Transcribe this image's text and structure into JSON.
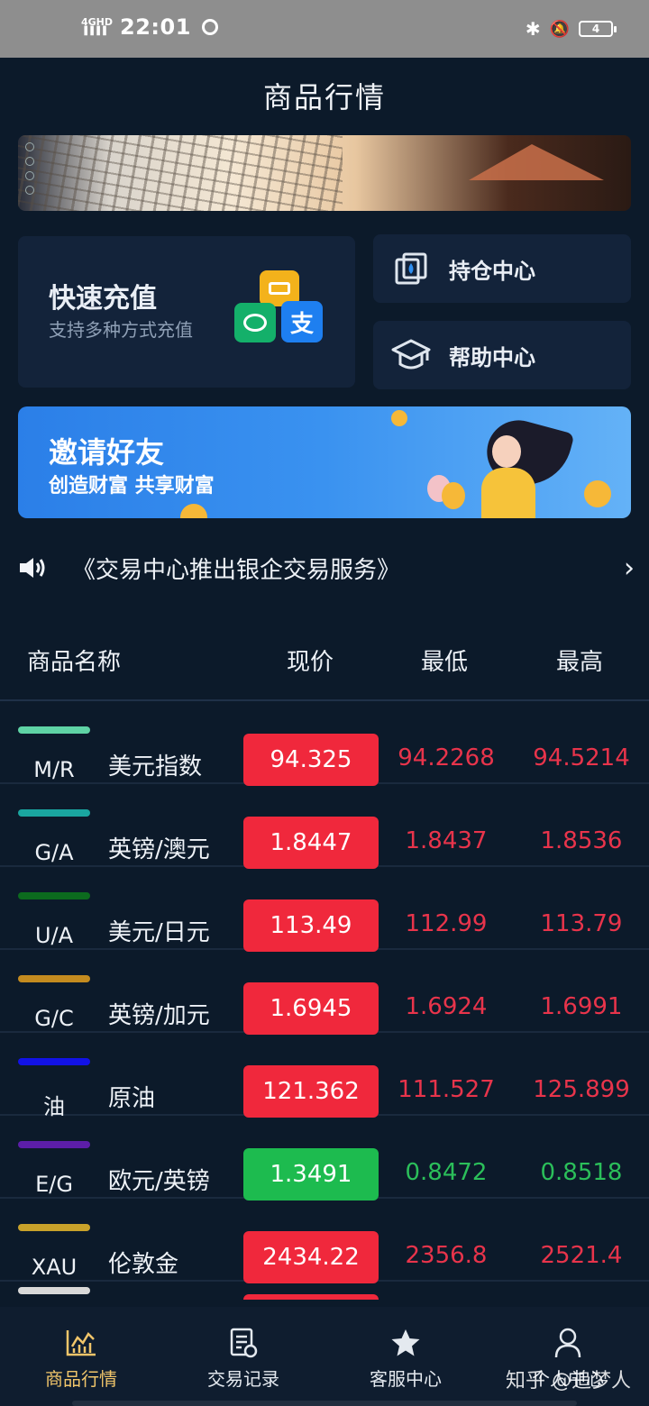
{
  "status_bar": {
    "network": "4GHD",
    "signal": "▐▐▐▐",
    "time": "22:01",
    "battery": "4"
  },
  "header": {
    "title": "商品行情"
  },
  "recharge": {
    "title": "快速充值",
    "subtitle": "支持多种方式充值",
    "alipay_char": "支"
  },
  "menu": {
    "hold": "持仓中心",
    "help": "帮助中心"
  },
  "invite": {
    "title": "邀请好友",
    "subtitle": "创造财富 共享财富"
  },
  "notice": {
    "text": "《交易中心推出银企交易服务》"
  },
  "table": {
    "headers": {
      "name": "商品名称",
      "price": "现价",
      "low": "最低",
      "high": "最高"
    },
    "rows": [
      {
        "code": "M/R",
        "name": "美元指数",
        "price": "94.325",
        "low": "94.2268",
        "high": "94.5214",
        "trend": "up",
        "tag_color": "#5fd3a5"
      },
      {
        "code": "G/A",
        "name": "英镑/澳元",
        "price": "1.8447",
        "low": "1.8437",
        "high": "1.8536",
        "trend": "up",
        "tag_color": "#1aa6a0"
      },
      {
        "code": "U/A",
        "name": "美元/日元",
        "price": "113.49",
        "low": "112.99",
        "high": "113.79",
        "trend": "up",
        "tag_color": "#0c6b1e"
      },
      {
        "code": "G/C",
        "name": "英镑/加元",
        "price": "1.6945",
        "low": "1.6924",
        "high": "1.6991",
        "trend": "up",
        "tag_color": "#c48b1f"
      },
      {
        "code": "油",
        "name": "原油",
        "price": "121.362",
        "low": "111.527",
        "high": "125.899",
        "trend": "up",
        "tag_color": "#1212e6"
      },
      {
        "code": "E/G",
        "name": "欧元/英镑",
        "price": "1.3491",
        "low": "0.8472",
        "high": "0.8518",
        "trend": "down",
        "tag_color": "#5c1ea8"
      },
      {
        "code": "XAU",
        "name": "伦敦金",
        "price": "2434.22",
        "low": "2356.8",
        "high": "2521.4",
        "trend": "up",
        "tag_color": "#c9a22a"
      }
    ]
  },
  "bottom_nav": [
    {
      "label": "商品行情",
      "icon": "chart-icon",
      "active": true
    },
    {
      "label": "交易记录",
      "icon": "record-icon",
      "active": false
    },
    {
      "label": "客服中心",
      "icon": "star-icon",
      "active": false
    },
    {
      "label": "个人中心",
      "icon": "user-icon",
      "active": false
    }
  ],
  "watermark": "知乎 @追梦人",
  "colors": {
    "up": "#f0283c",
    "down": "#1dbb4f",
    "active_tab": "#f0c56a",
    "background": "#0c1a2a"
  }
}
